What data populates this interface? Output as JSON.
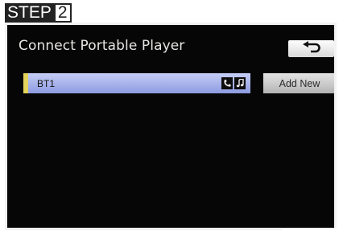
{
  "step": {
    "word": "STEP",
    "number": "2"
  },
  "screen": {
    "title": "Connect Portable Player",
    "back_icon": "return-arrow-icon",
    "devices": [
      {
        "name": "BT1",
        "icons": [
          "phone-icon",
          "music-note-icon"
        ]
      }
    ],
    "add_new_label": "Add New"
  },
  "colors": {
    "screen_bg": "#060607",
    "row_highlight": "#a8b4ee",
    "row_marker": "#e3d35a",
    "button": "#d4d4d4"
  }
}
